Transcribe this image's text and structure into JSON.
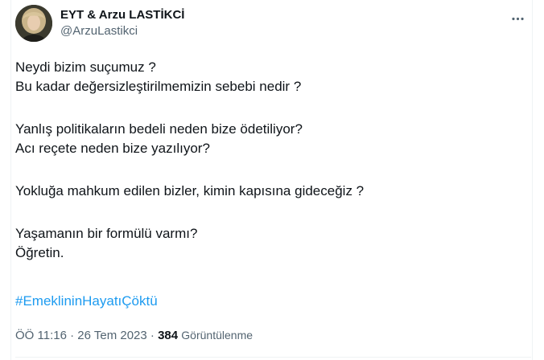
{
  "author": {
    "display_name": "EYT & Arzu LASTİKCİ",
    "handle": "@ArzuLastikci",
    "avatar_icon": "profile-photo"
  },
  "more_icon": "more-horizontal-icon",
  "tweet": {
    "lines": [
      "Neydi bizim suçumuz ?",
      "Bu kadar değersizleştirilmemizin sebebi nedir ?",
      "",
      "Yanlış politikaların bedeli neden bize ödetiliyor?",
      "Acı reçete neden bize yazılıyor?",
      "",
      "Yokluğa mahkum edilen bizler, kimin kapısına gideceğiz ?",
      "",
      "Yaşamanın bir formülü varmı?",
      "Öğretin."
    ],
    "hashtag": "#EmeklininHayatıÇöktü"
  },
  "meta": {
    "time": "ÖÖ 11:16",
    "separator_1": " · ",
    "date": "26 Tem 2023",
    "separator_2": " · ",
    "views_count": "384",
    "views_label": "Görüntülenme"
  },
  "colors": {
    "text_primary": "#0f1419",
    "text_secondary": "#536471",
    "link": "#1d9bf0",
    "border": "#eff3f4"
  }
}
